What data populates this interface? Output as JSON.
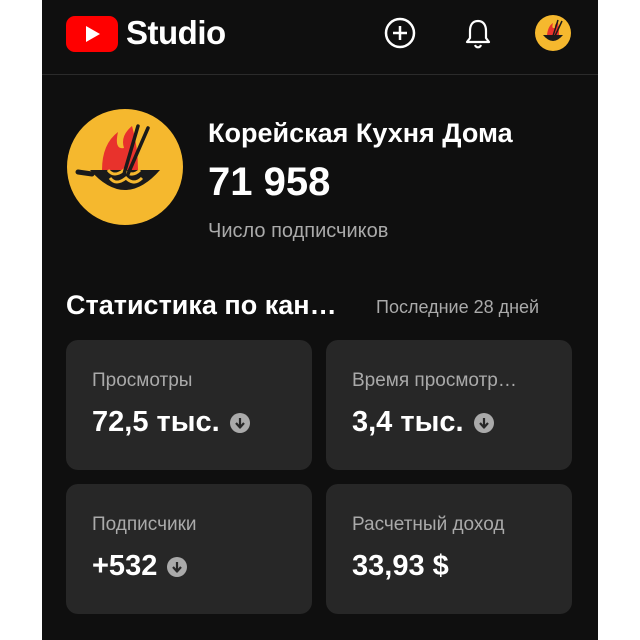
{
  "header": {
    "app_name": "Studio",
    "logo_icon": "youtube-logo-icon",
    "create_icon": "add-circle-icon",
    "notifications_icon": "bell-icon",
    "account_icon": "avatar"
  },
  "channel": {
    "name": "Корейская Кухня Дома",
    "subscribers": "71 958",
    "subscribers_label": "Число подписчиков"
  },
  "analytics": {
    "title": "Статистика по кан…",
    "period": "Последние 28 дней",
    "cards": [
      {
        "label": "Просмотры",
        "value": "72,5 тыс.",
        "trend": "down"
      },
      {
        "label": "Время просмотр…",
        "value": "3,4 тыс.",
        "trend": "down"
      },
      {
        "label": "Подписчики",
        "value": "+532",
        "trend": "down"
      },
      {
        "label": "Расчетный доход",
        "value": "33,93 $",
        "trend": "none"
      }
    ]
  },
  "colors": {
    "background": "#0f0f0f",
    "card": "#272727",
    "brand_red": "#ff0000",
    "secondary_text": "#aaaaaa",
    "avatar_yellow": "#f5b82e"
  }
}
